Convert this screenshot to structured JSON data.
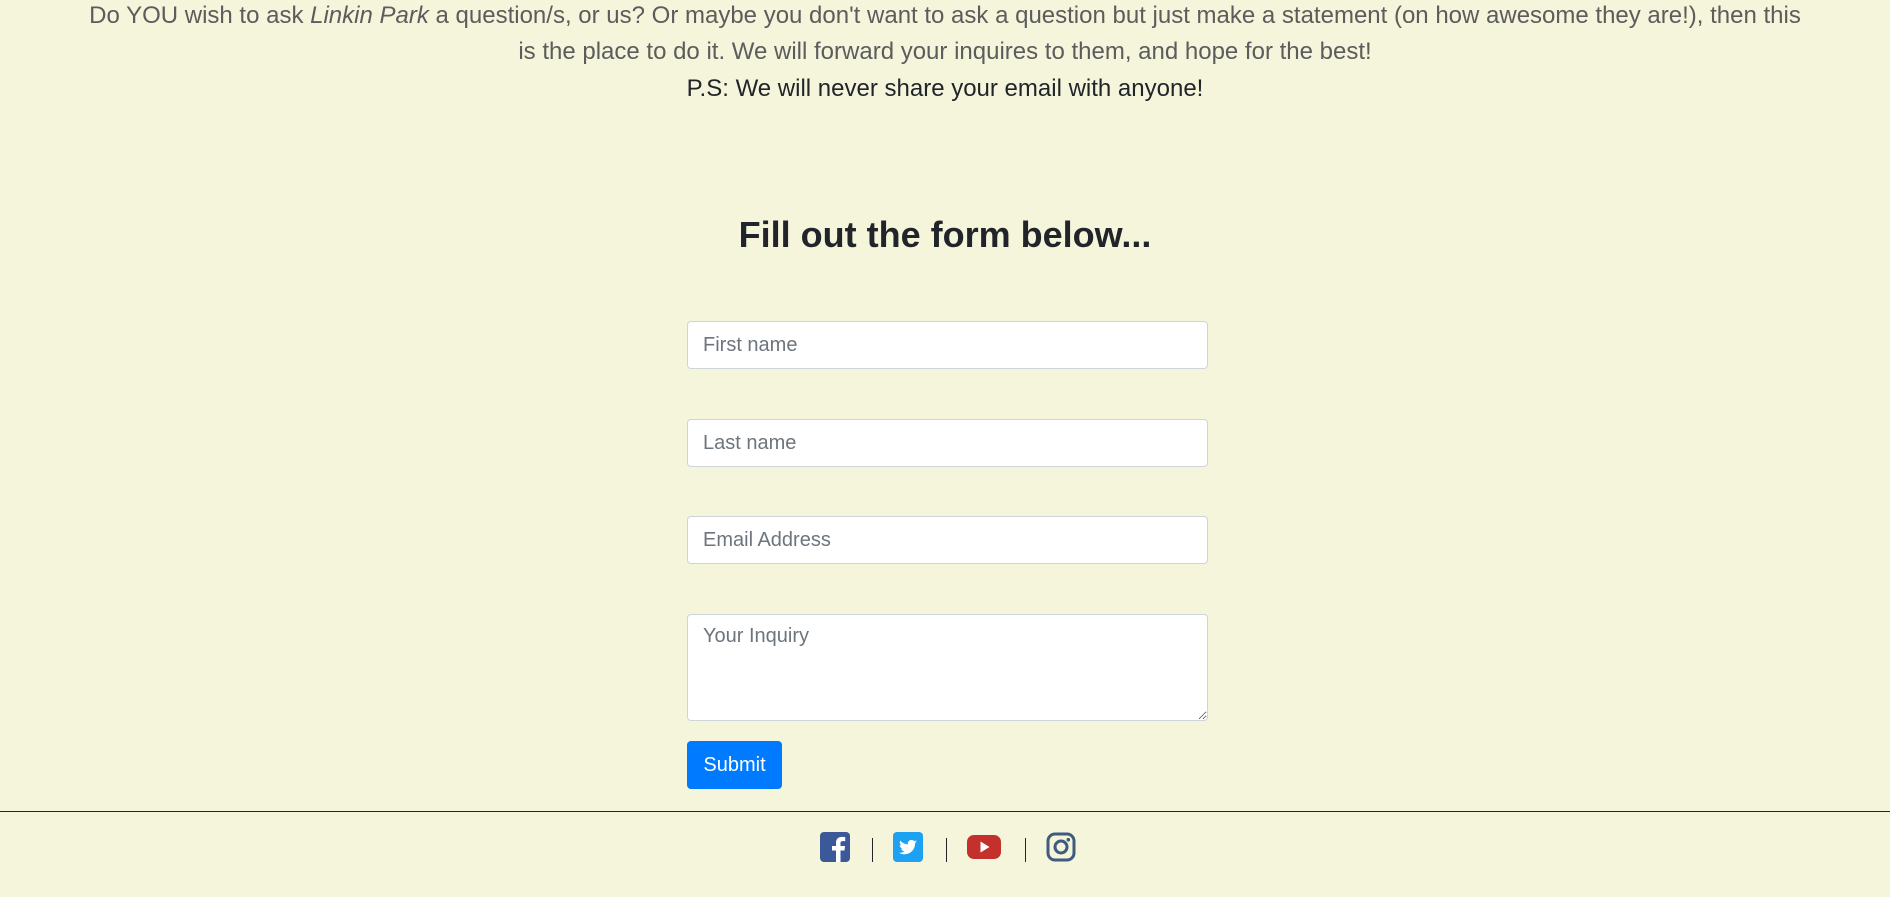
{
  "intro": {
    "pre": "Do YOU wish to ask ",
    "band": "Linkin Park",
    "post": " a question/s, or us? Or maybe you don't want to ask a question but just make a statement (on how awesome they are!), then this is the place to do it. We will forward your inquires to them, and hope for the best!",
    "ps": "P.S: We will never share your email with anyone!"
  },
  "form": {
    "title": "Fill out the form below...",
    "first_name_placeholder": "First name",
    "last_name_placeholder": "Last name",
    "email_placeholder": "Email Address",
    "inquiry_placeholder": "Your Inquiry",
    "submit_label": "Submit"
  },
  "footer": {
    "icons": [
      "facebook-icon",
      "twitter-icon",
      "youtube-icon",
      "instagram-icon"
    ]
  },
  "colors": {
    "background": "#f5f5dc",
    "button": "#007bff",
    "facebook": "#3b5998",
    "twitter": "#1da1f2",
    "youtube": "#c4302b",
    "instagram": "#3f5b7e"
  }
}
